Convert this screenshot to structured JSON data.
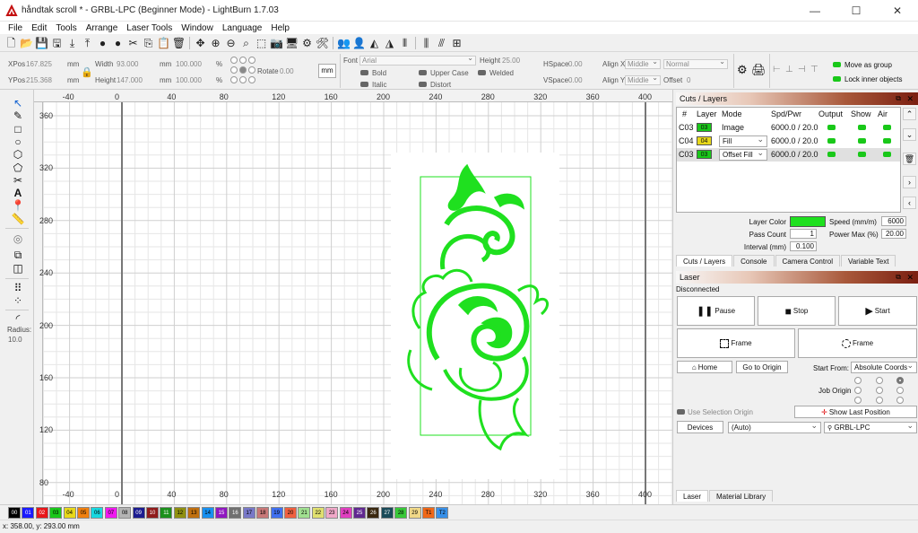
{
  "window": {
    "title": "håndtak scroll * - GRBL-LPC (Beginner Mode) - LightBurn 1.7.03",
    "minimize": "—",
    "maximize": "☐",
    "close": "✕"
  },
  "menu": [
    "File",
    "Edit",
    "Tools",
    "Arrange",
    "Laser Tools",
    "Window",
    "Language",
    "Help"
  ],
  "props": {
    "xpos_label": "XPos",
    "xpos_value": "167.825",
    "xpos_unit": "mm",
    "ypos_label": "YPos",
    "ypos_value": "215.368",
    "ypos_unit": "mm",
    "width_label": "Width",
    "width_value": "93.000",
    "width_unit": "mm",
    "width_pct": "100.000",
    "pct": "%",
    "height_label": "Height",
    "height_value": "147.000",
    "height_unit": "mm",
    "height_pct": "100.000",
    "rotate_label": "Rotate",
    "rotate_value": "0.00",
    "mm_button": "mm",
    "font_label": "Font",
    "font_value": "Arial",
    "fheight_label": "Height",
    "fheight_value": "25.00",
    "bold": "Bold",
    "italic": "Italic",
    "upper_case": "Upper Case",
    "welded": "Welded",
    "distort": "Distort",
    "hspace_label": "HSpace",
    "hspace_value": "0.00",
    "vspace_label": "VSpace",
    "vspace_value": "0.00",
    "alignx_label": "Align X",
    "alignx_value": "Middle",
    "aligny_label": "Align Y",
    "aligny_value": "Middle",
    "normal_value": "Normal",
    "offset_label": "Offset",
    "offset_value": "0",
    "move_as_group": "Move as group",
    "lock_inner": "Lock inner objects"
  },
  "left_tools": {
    "radius_label": "Radius:",
    "radius_value": "10.0"
  },
  "ruler": {
    "x_ticks": [
      "-40",
      "0",
      "40",
      "80",
      "120",
      "160",
      "200",
      "240",
      "280",
      "320",
      "360",
      "400"
    ],
    "y_ticks": [
      "360",
      "320",
      "280",
      "240",
      "200",
      "160",
      "120",
      "80",
      "40"
    ],
    "bottom_ticks": [
      "-40",
      "0",
      "40",
      "80",
      "120",
      "160",
      "200",
      "240",
      "280",
      "320",
      "360",
      "400"
    ]
  },
  "cuts": {
    "title": "Cuts / Layers",
    "headers": [
      "#",
      "Layer",
      "Mode",
      "Spd/Pwr",
      "Output",
      "Show",
      "Air"
    ],
    "rows": [
      {
        "num": "C03",
        "layer": "03",
        "color": "#19c819",
        "mode": "Image",
        "spdpwr": "6000.0 / 20.0"
      },
      {
        "num": "C04",
        "layer": "04",
        "color": "#e8d81a",
        "mode": "Fill",
        "spdpwr": "6000.0 / 20.0"
      },
      {
        "num": "C03",
        "layer": "03",
        "color": "#19c819",
        "mode": "Offset Fill",
        "spdpwr": "6000.0 / 20.0"
      }
    ],
    "layer_color_label": "Layer Color",
    "layer_color": "#1fe01f",
    "speed_label": "Speed (mm/m)",
    "speed_value": "6000",
    "pass_count_label": "Pass Count",
    "pass_count_value": "1",
    "power_label": "Power Max (%)",
    "power_value": "20.00",
    "interval_label": "Interval (mm)",
    "interval_value": "0.100",
    "tabs": [
      "Cuts / Layers",
      "Console",
      "Camera Control",
      "Variable Text"
    ]
  },
  "laser": {
    "title": "Laser",
    "status": "Disconnected",
    "pause": "Pause",
    "stop": "Stop",
    "start": "Start",
    "frame1": "Frame",
    "frame2": "Frame",
    "home": "Home",
    "go_to_origin": "Go to Origin",
    "start_from_label": "Start From:",
    "start_from_value": "Absolute Coords",
    "job_origin_label": "Job Origin",
    "use_selection_origin": "Use Selection Origin",
    "show_last_position": "Show Last Position",
    "devices": "Devices",
    "device_auto": "(Auto)",
    "device_name": "GRBL-LPC",
    "tabs": [
      "Laser",
      "Material Library"
    ]
  },
  "palette": [
    {
      "label": "00",
      "color": "#000000",
      "text": "#ffffff"
    },
    {
      "label": "01",
      "color": "#1a1aff",
      "text": "#ffffff"
    },
    {
      "label": "02",
      "color": "#e8161a",
      "text": "#ffffff"
    },
    {
      "label": "03",
      "color": "#19c819",
      "text": "#000000"
    },
    {
      "label": "04",
      "color": "#e8d81a",
      "text": "#000000"
    },
    {
      "label": "05",
      "color": "#f08010",
      "text": "#000000"
    },
    {
      "label": "06",
      "color": "#18d8e0",
      "text": "#000000"
    },
    {
      "label": "07",
      "color": "#f018f0",
      "text": "#000000"
    },
    {
      "label": "08",
      "color": "#b4b4b4",
      "text": "#000000"
    },
    {
      "label": "09",
      "color": "#1c1c90",
      "text": "#ffffff"
    },
    {
      "label": "10",
      "color": "#901c1c",
      "text": "#ffffff"
    },
    {
      "label": "11",
      "color": "#1c901c",
      "text": "#ffffff"
    },
    {
      "label": "12",
      "color": "#909010",
      "text": "#000000"
    },
    {
      "label": "13",
      "color": "#c07010",
      "text": "#000000"
    },
    {
      "label": "14",
      "color": "#1890f0",
      "text": "#000000"
    },
    {
      "label": "15",
      "color": "#9018c0",
      "text": "#ffffff"
    },
    {
      "label": "16",
      "color": "#707070",
      "text": "#ffffff"
    },
    {
      "label": "17",
      "color": "#7878c8",
      "text": "#000000"
    },
    {
      "label": "18",
      "color": "#c87878",
      "text": "#000000"
    },
    {
      "label": "19",
      "color": "#4070f0",
      "text": "#000000"
    },
    {
      "label": "20",
      "color": "#f06040",
      "text": "#000000"
    },
    {
      "label": "21",
      "color": "#a0e090",
      "text": "#000000"
    },
    {
      "label": "22",
      "color": "#e0e070",
      "text": "#000000"
    },
    {
      "label": "23",
      "color": "#f0a8c8",
      "text": "#000000"
    },
    {
      "label": "24",
      "color": "#e040c0",
      "text": "#000000"
    },
    {
      "label": "25",
      "color": "#602890",
      "text": "#ffffff"
    },
    {
      "label": "26",
      "color": "#3a2810",
      "text": "#ffffff"
    },
    {
      "label": "27",
      "color": "#1a4a58",
      "text": "#ffffff"
    },
    {
      "label": "28",
      "color": "#38c838",
      "text": "#000000"
    },
    {
      "label": "29",
      "color": "#f0d888",
      "text": "#000000"
    },
    {
      "label": "T1",
      "color": "#f06818",
      "text": "#000000"
    },
    {
      "label": "T2",
      "color": "#3890e8",
      "text": "#000000"
    }
  ],
  "status_bar": "x: 358.00, y: 293.00 mm"
}
